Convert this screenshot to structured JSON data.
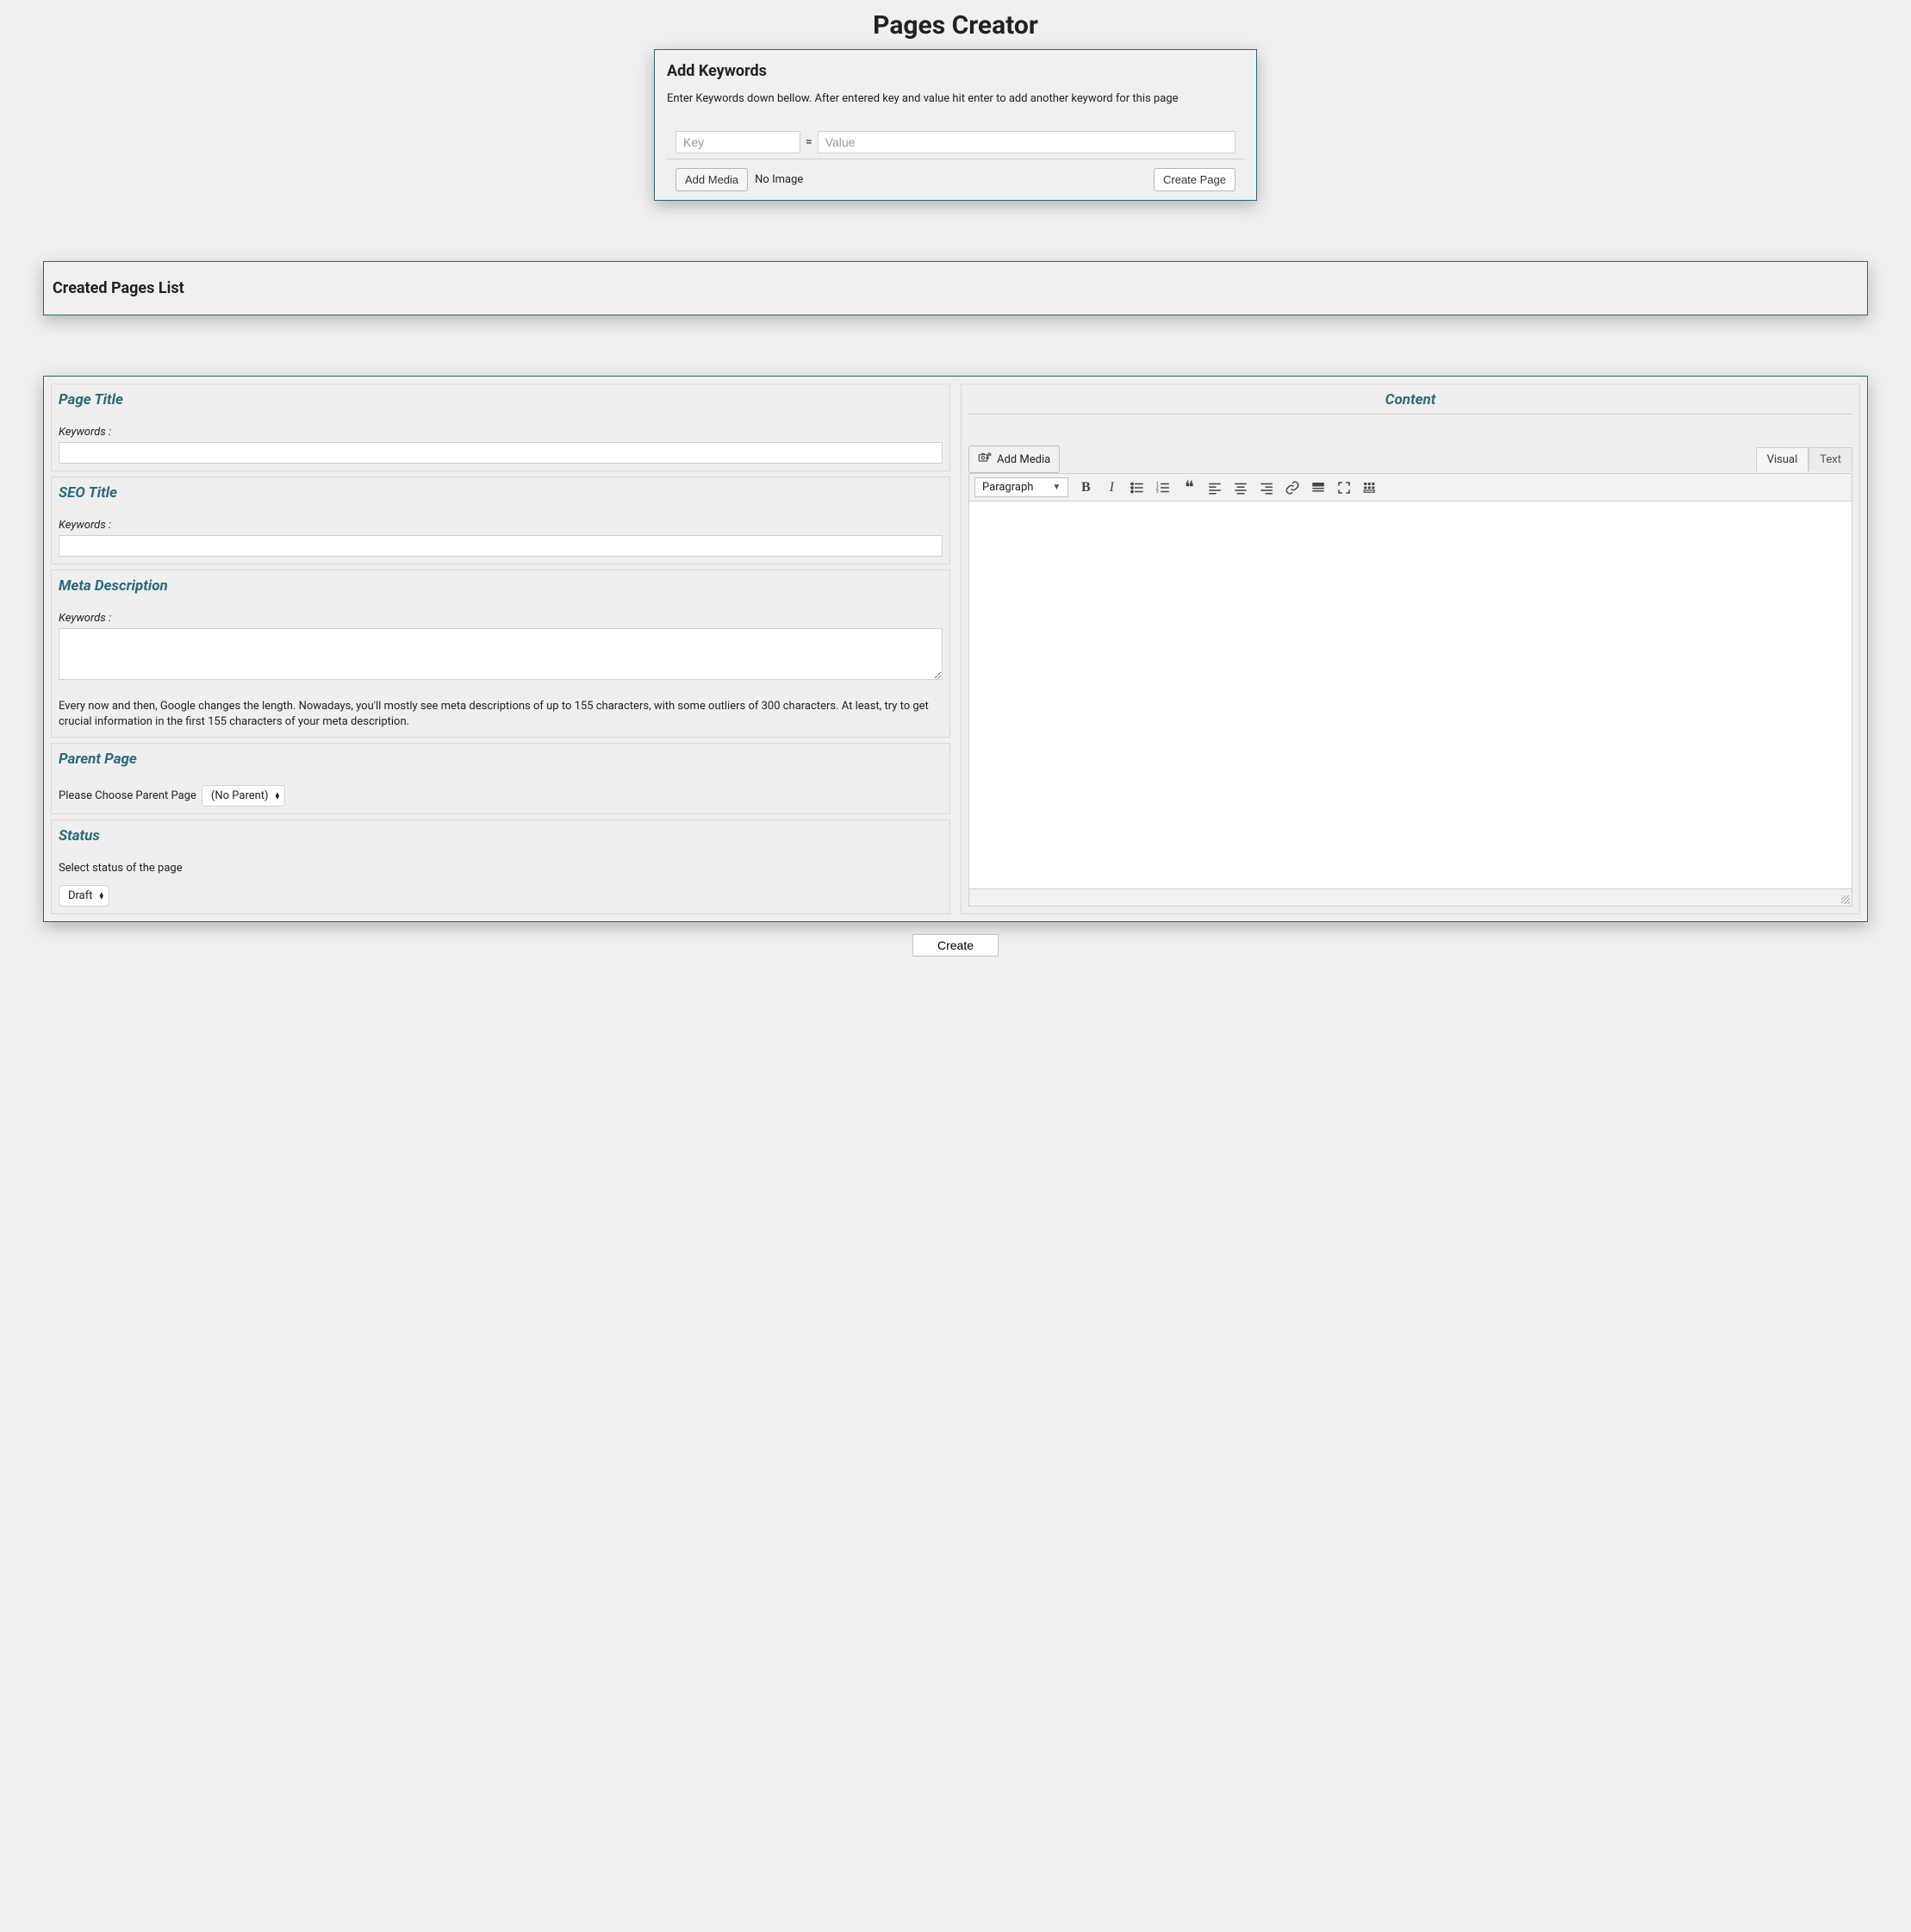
{
  "heading": "Pages Creator",
  "keywords_panel": {
    "title": "Add Keywords",
    "description": "Enter Keywords down bellow. After entered key and value hit enter to add another keyword for this page",
    "key_placeholder": "Key",
    "eq": "=",
    "value_placeholder": "Value",
    "add_media_label": "Add Media",
    "no_image_text": "No Image",
    "create_page_label": "Create Page"
  },
  "created_list": {
    "title": "Created Pages List"
  },
  "form": {
    "page_title": {
      "heading": "Page Title",
      "keywords_label": "Keywords :"
    },
    "seo_title": {
      "heading": "SEO Title",
      "keywords_label": "Keywords :"
    },
    "meta_desc": {
      "heading": "Meta Description",
      "keywords_label": "Keywords :",
      "help": "Every now and then, Google changes the length. Nowadays, you'll mostly see meta descriptions of up to 155 characters, with some outliers of 300 characters. At least, try to get crucial information in the first 155 characters of your meta description."
    },
    "parent_page": {
      "heading": "Parent Page",
      "label": "Please Choose Parent Page",
      "value": "(No Parent)"
    },
    "status": {
      "heading": "Status",
      "label": "Select status of the page",
      "value": "Draft"
    }
  },
  "editor": {
    "heading": "Content",
    "add_media_label": "Add Media",
    "tabs": {
      "visual": "Visual",
      "text": "Text"
    },
    "paragraph_label": "Paragraph"
  },
  "bottom": {
    "create_label": "Create"
  }
}
